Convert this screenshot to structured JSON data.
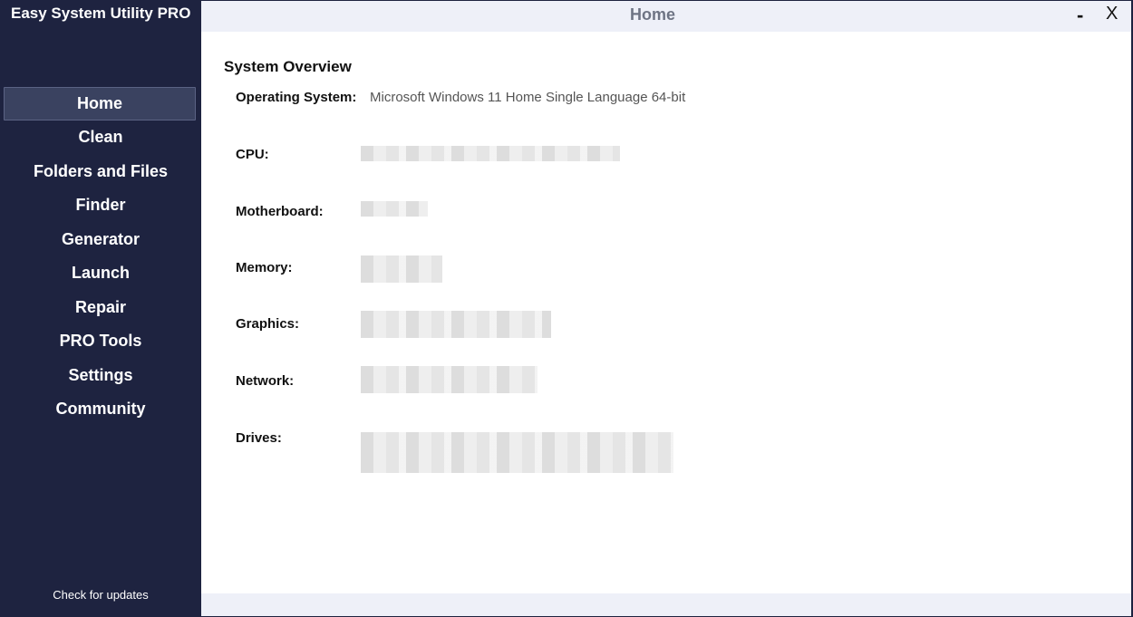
{
  "app": {
    "title": "Easy System Utility PRO"
  },
  "sidebar": {
    "items": [
      {
        "label": "Home"
      },
      {
        "label": "Clean"
      },
      {
        "label": "Folders and Files"
      },
      {
        "label": "Finder"
      },
      {
        "label": "Generator"
      },
      {
        "label": "Launch"
      },
      {
        "label": "Repair"
      },
      {
        "label": "PRO Tools"
      },
      {
        "label": "Settings"
      },
      {
        "label": "Community"
      }
    ],
    "active": "Home",
    "check_updates": "Check for updates"
  },
  "window": {
    "title": "Home",
    "minimize_label": "-",
    "close_label": "X"
  },
  "overview": {
    "title": "System Overview",
    "os": {
      "label": "Operating System:",
      "value": "Microsoft Windows 11 Home Single Language 64-bit"
    },
    "cpu": {
      "label": "CPU:"
    },
    "motherboard": {
      "label": "Motherboard:"
    },
    "memory": {
      "label": "Memory:"
    },
    "graphics": {
      "label": "Graphics:"
    },
    "network": {
      "label": "Network:"
    },
    "drives": {
      "label": "Drives:"
    }
  },
  "colors": {
    "sidebar_bg": "#1e2340",
    "active_item_bg": "#3a4260",
    "titlebar_bg": "#eef0f8"
  }
}
